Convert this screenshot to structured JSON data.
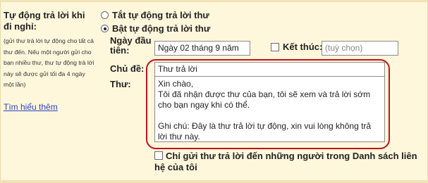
{
  "section": {
    "title": "Tự động trả lời khi đi nghỉ:",
    "help_text": "(gửi thư trả lời tự động cho tất cả thư đến. Nếu một người gửi cho bạn nhiều thư, thư tự động trả lời này sẽ được gửi tối đa 4 ngày một lần)",
    "learn_more": "Tìm hiểu thêm"
  },
  "radios": {
    "off_label": "Tắt tự động trả lời thư",
    "on_label": "Bật tự động trả lời thư",
    "selected": "on"
  },
  "fields": {
    "start_label": "Ngày đầu tiên:",
    "start_value": "Ngày 02 tháng 9 năm",
    "end_label": "Kết thúc:",
    "end_placeholder": "(tuỳ chọn)",
    "subject_label": "Chủ đề:",
    "subject_value": "Thư trả lời",
    "body_label": "Thư:",
    "body_value": "Xin chào,\nTôi đã nhận được thư của bạn, tôi sẽ xem và trả lời sớm cho bạn ngay khi có thể.\n\nGhi chú: Đây là thư trả lời tự động, xin vui lòng không trả lời thư này."
  },
  "contacts_only_label": "Chỉ gửi thư trả lời đến những người trong Danh sách liên hệ của tôi",
  "colors": {
    "background": "#fff7dc",
    "link": "#2a45c6",
    "highlight": "#c1121f"
  }
}
